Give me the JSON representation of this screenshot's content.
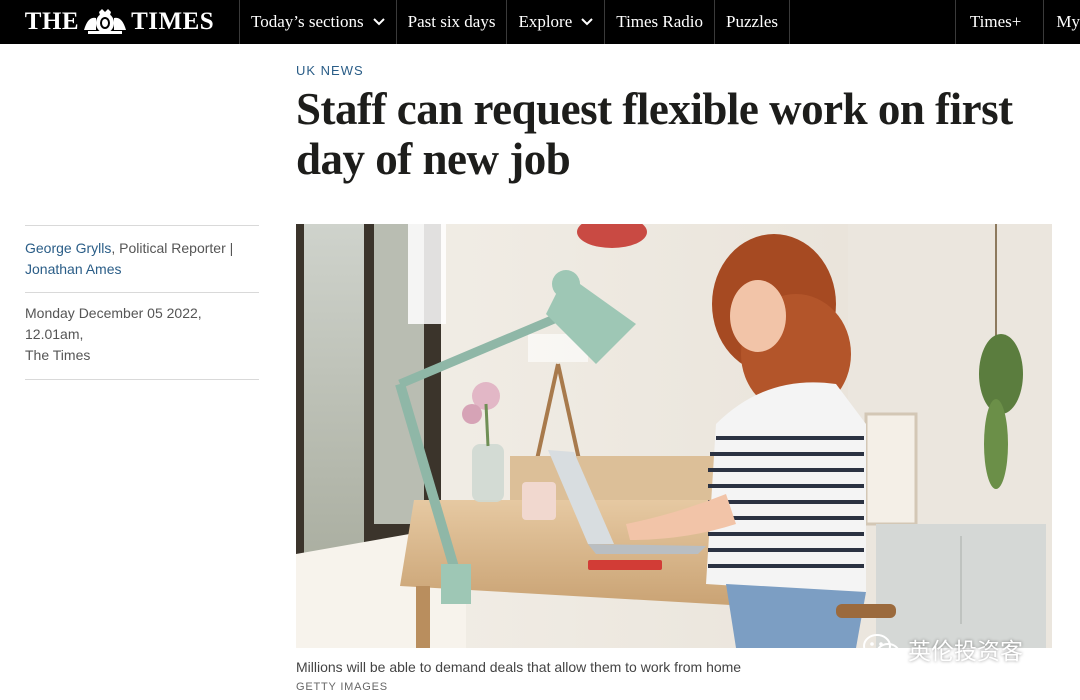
{
  "nav": {
    "logo_left": "THE",
    "logo_right": "TIMES",
    "items": [
      {
        "label": "Today’s sections",
        "dropdown": true
      },
      {
        "label": "Past six days",
        "dropdown": false
      },
      {
        "label": "Explore",
        "dropdown": true
      },
      {
        "label": "Times Radio",
        "dropdown": false
      },
      {
        "label": "Puzzles",
        "dropdown": false
      }
    ],
    "right_items": [
      "Times+",
      "My"
    ]
  },
  "article": {
    "section": "UK NEWS",
    "headline": "Staff can request flexible work on first day of new job",
    "authors": [
      {
        "name": "George Grylls",
        "role": ", Political Reporter |"
      },
      {
        "name": "Jonathan Ames",
        "role": ""
      }
    ],
    "date": "Monday December 05 2022, 12.01am,",
    "publication": "The Times",
    "image_caption": "Millions will be able to demand deals that allow them to work from home",
    "image_credit": "GETTY IMAGES"
  },
  "watermark": {
    "text": "英伦投资客",
    "icon": "wechat-icon"
  },
  "colors": {
    "nav_bg": "#000000",
    "section_link": "#2a5d87",
    "headline": "#1d1d1b"
  }
}
